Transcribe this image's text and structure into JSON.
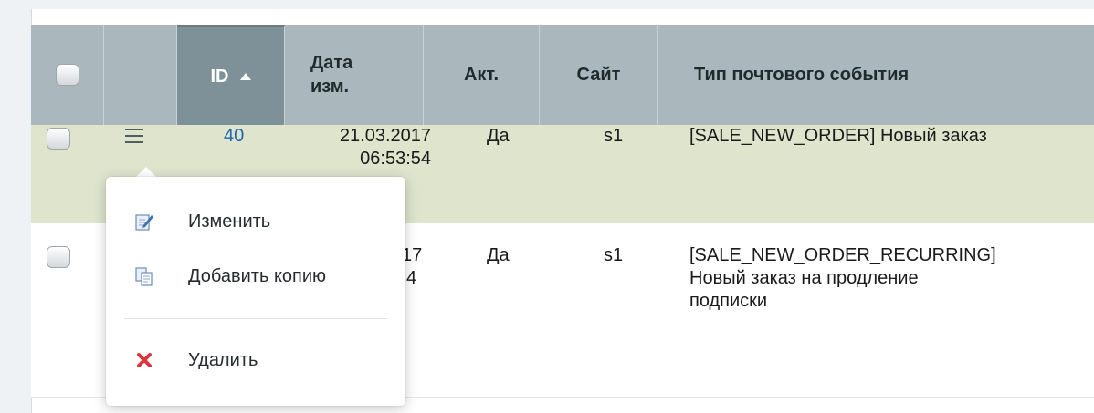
{
  "table": {
    "columns": [
      {
        "key": "select",
        "label": ""
      },
      {
        "key": "actions",
        "label": ""
      },
      {
        "key": "id",
        "label": "ID"
      },
      {
        "key": "date",
        "label": "Дата\nизм."
      },
      {
        "key": "active",
        "label": "Акт."
      },
      {
        "key": "site",
        "label": "Сайт"
      },
      {
        "key": "type",
        "label": "Тип почтового события"
      }
    ],
    "header": {
      "id": "ID",
      "date_line1": "Дата",
      "date_line2": "изм.",
      "active": "Акт.",
      "site": "Сайт",
      "type": "Тип почтового события"
    },
    "rows": [
      {
        "id": "40",
        "date_line1": "21.03.2017",
        "date_line2": "06:53:54",
        "active": "Да",
        "site": "s1",
        "type_line1": "[SALE_NEW_ORDER] Новый заказ"
      },
      {
        "date_partial1": "17",
        "date_partial2": "4",
        "active": "Да",
        "site": "s1",
        "type_line1": "[SALE_NEW_ORDER_RECURRING]",
        "type_line2": "Новый заказ на продление",
        "type_line3": "подписки"
      }
    ]
  },
  "context_menu": {
    "items": [
      {
        "label": "Изменить",
        "icon": "edit-icon"
      },
      {
        "label": "Добавить копию",
        "icon": "copy-icon"
      },
      {
        "label": "Удалить",
        "icon": "delete-icon"
      }
    ]
  },
  "colors": {
    "header_bg": "#aab7bd",
    "sorted_header_bg": "#7e9098",
    "selected_row_bg": "#dfe4cd",
    "link": "#2067b0",
    "delete_red": "#d9363e"
  }
}
